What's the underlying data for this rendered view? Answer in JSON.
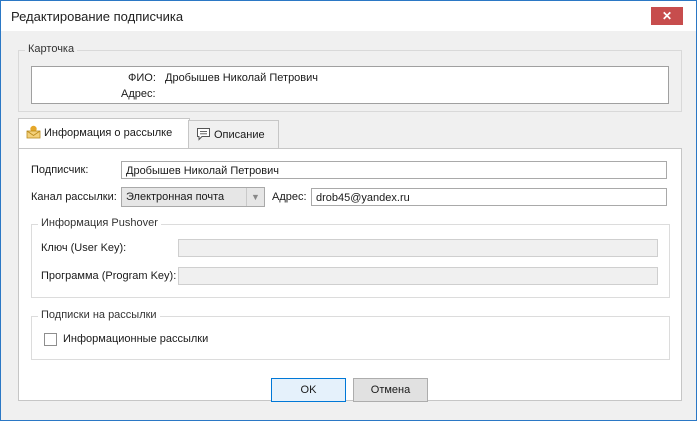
{
  "window": {
    "title": "Редактирование подписчика",
    "close_glyph": "✕"
  },
  "card": {
    "group_title": "Карточка",
    "fio_label": "ФИО:",
    "fio_value": "Дробышев Николай Петрович",
    "address_label": "Адрес:",
    "address_value": ""
  },
  "tabs": [
    {
      "label": "Информация о рассылке",
      "icon": "envelope-icon",
      "active": true
    },
    {
      "label": "Описание",
      "icon": "speech-bubble-icon",
      "active": false
    }
  ],
  "form": {
    "subscriber_label": "Подписчик:",
    "subscriber_value": "Дробышев Николай Петрович",
    "channel_label": "Канал рассылки:",
    "channel_value": "Электронная почта",
    "address_label": "Адрес:",
    "address_value": "drob45@yandex.ru"
  },
  "pushover": {
    "group_title": "Информация Pushover",
    "user_key_label": "Ключ (User Key):",
    "user_key_value": "",
    "program_key_label": "Программа (Program Key):",
    "program_key_value": ""
  },
  "subscriptions": {
    "group_title": "Подписки на рассылки",
    "items": [
      {
        "label": "Информационные рассылки",
        "checked": false
      }
    ]
  },
  "buttons": {
    "ok": "OK",
    "cancel": "Отмена"
  },
  "colors": {
    "border_accent": "#2b78c5",
    "close_bg": "#c74d4d",
    "default_button_border": "#0078d7"
  }
}
